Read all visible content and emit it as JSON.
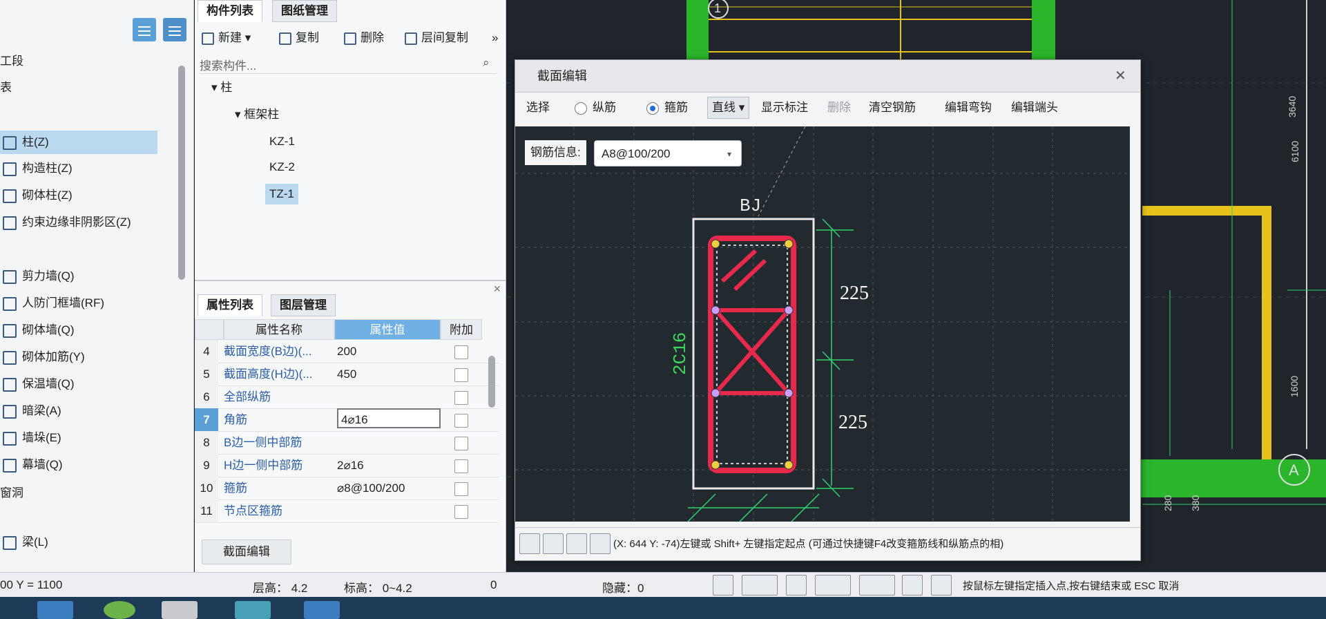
{
  "left_nav": {
    "top_items": [
      "工段",
      "表"
    ],
    "items": [
      {
        "label": "柱(Z)",
        "selected": true
      },
      {
        "label": "构造柱(Z)"
      },
      {
        "label": "砌体柱(Z)"
      },
      {
        "label": "约束边缘非阴影区(Z)"
      },
      {
        "label": "剪力墙(Q)"
      },
      {
        "label": "人防门框墙(RF)"
      },
      {
        "label": "砌体墙(Q)"
      },
      {
        "label": "砌体加筋(Y)"
      },
      {
        "label": "保温墙(Q)"
      },
      {
        "label": "暗梁(A)"
      },
      {
        "label": "墙垛(E)"
      },
      {
        "label": "幕墙(Q)"
      }
    ],
    "group_hole": "窗洞",
    "beam_item": "梁(L)"
  },
  "component_panel": {
    "tabs": [
      "构件列表",
      "图纸管理"
    ],
    "toolbar": {
      "new": "新建",
      "copy": "复制",
      "delete": "删除",
      "floor_copy": "层间复制"
    },
    "search_placeholder": "搜索构件...",
    "tree": {
      "root": "柱",
      "group": "框架柱",
      "items": [
        "KZ-1",
        "KZ-2",
        "TZ-1"
      ],
      "selected": "TZ-1"
    }
  },
  "property_panel": {
    "tabs": [
      "属性列表",
      "图层管理"
    ],
    "headers": {
      "name": "属性名称",
      "value": "属性值",
      "extra": "附加"
    },
    "rows": [
      {
        "num": "4",
        "name": "截面宽度(B边)(...",
        "value": "200"
      },
      {
        "num": "5",
        "name": "截面高度(H边)(...",
        "value": "450"
      },
      {
        "num": "6",
        "name": "全部纵筋",
        "value": ""
      },
      {
        "num": "7",
        "name": "角筋",
        "value": "4⌀16",
        "selected": true
      },
      {
        "num": "8",
        "name": "B边一侧中部筋",
        "value": ""
      },
      {
        "num": "9",
        "name": "H边一侧中部筋",
        "value": "2⌀16"
      },
      {
        "num": "10",
        "name": "箍筋",
        "value": "⌀8@100/200"
      },
      {
        "num": "11",
        "name": "节点区箍筋",
        "value": ""
      }
    ],
    "section_edit_button": "截面编辑"
  },
  "dialog": {
    "title": "截面编辑",
    "toolbar": {
      "select": "选择",
      "longitudinal": "纵筋",
      "stirrup": "箍筋",
      "line_mode": "直线",
      "show_dims": "显示标注",
      "delete": "删除",
      "clear_rebar": "清空钢筋",
      "edit_hook": "编辑弯钩",
      "edit_end": "编辑端头"
    },
    "rebar_info_label": "钢筋信息:",
    "rebar_info_value": "A8@100/200",
    "drawing": {
      "top_label": "BJ",
      "side_label": "2C16",
      "dim_upper": "225",
      "dim_lower": "225"
    },
    "status_text": "(X: 644 Y: -74)左键或 Shift+ 左键指定起点 (可通过快捷键F4改变箍筋线和纵筋点的相)"
  },
  "cad_labels": {
    "axis_1": "1",
    "axis_a": "A",
    "dim_3640": "3640",
    "dim_6100": "6100",
    "dim_1600": "1600",
    "dim_280": "280",
    "dim_380": "380"
  },
  "footer": {
    "coord": "00 Y = 1100",
    "floor_height": "层高： 4.2",
    "elevation": "标高： 0~4.2",
    "zero": "0",
    "hidden": "隐藏：0",
    "hint": "按鼠标左键指定插入点,按右键结束或 ESC 取消"
  },
  "colors": {
    "accent": "#5a9fd6",
    "rebar": "#e8294b",
    "dim_line": "#2fd36b",
    "cad_green": "#2bb52b",
    "cad_yellow": "#e6c21a"
  }
}
